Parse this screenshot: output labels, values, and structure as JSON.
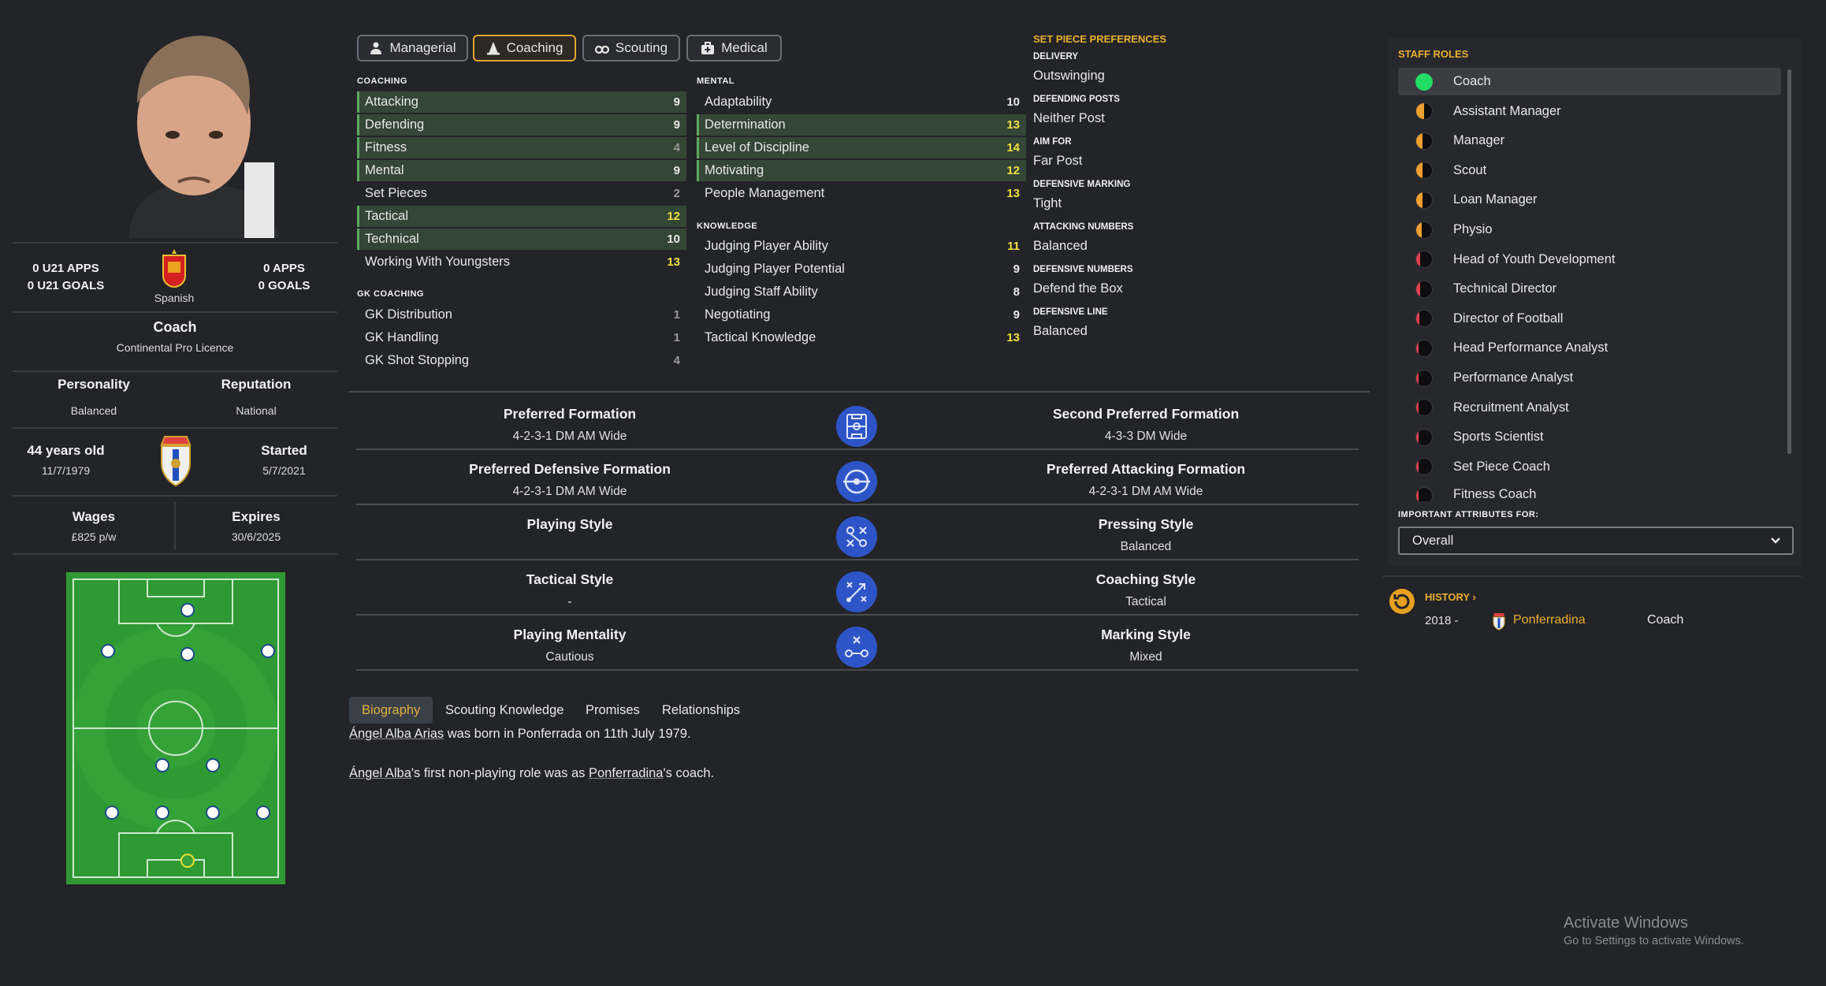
{
  "profile": {
    "u21_apps": "0 U21 APPS",
    "u21_goals": "0 U21 GOALS",
    "apps": "0 APPS",
    "goals": "0 GOALS",
    "nationality": "Spanish",
    "role": "Coach",
    "licence": "Continental Pro Licence",
    "personality_label": "Personality",
    "personality": "Balanced",
    "reputation_label": "Reputation",
    "reputation": "National",
    "age": "44 years old",
    "dob": "11/7/1979",
    "started_label": "Started",
    "started": "5/7/2021",
    "wages_label": "Wages",
    "wages": "£825 p/w",
    "expires_label": "Expires",
    "expires": "30/6/2025"
  },
  "tabs": [
    {
      "label": "Managerial",
      "icon": "manager-icon"
    },
    {
      "label": "Coaching",
      "icon": "cone-icon"
    },
    {
      "label": "Scouting",
      "icon": "binoculars-icon"
    },
    {
      "label": "Medical",
      "icon": "medkit-icon"
    }
  ],
  "coaching": {
    "title": "COACHING",
    "items": [
      {
        "name": "Attacking",
        "value": "9",
        "hl": true
      },
      {
        "name": "Defending",
        "value": "9",
        "hl": true
      },
      {
        "name": "Fitness",
        "value": "4",
        "hl": true
      },
      {
        "name": "Mental",
        "value": "9",
        "hl": true
      },
      {
        "name": "Set Pieces",
        "value": "2",
        "hl": false
      },
      {
        "name": "Tactical",
        "value": "12",
        "hl": true
      },
      {
        "name": "Technical",
        "value": "10",
        "hl": true
      },
      {
        "name": "Working With Youngsters",
        "value": "13",
        "hl": false
      }
    ]
  },
  "gk_coaching": {
    "title": "GK COACHING",
    "items": [
      {
        "name": "GK Distribution",
        "value": "1"
      },
      {
        "name": "GK Handling",
        "value": "1"
      },
      {
        "name": "GK Shot Stopping",
        "value": "4"
      }
    ]
  },
  "mental": {
    "title": "MENTAL",
    "items": [
      {
        "name": "Adaptability",
        "value": "10",
        "hl": false
      },
      {
        "name": "Determination",
        "value": "13",
        "hl": true
      },
      {
        "name": "Level of Discipline",
        "value": "14",
        "hl": true
      },
      {
        "name": "Motivating",
        "value": "12",
        "hl": true
      },
      {
        "name": "People Management",
        "value": "13",
        "hl": false
      }
    ]
  },
  "knowledge": {
    "title": "KNOWLEDGE",
    "items": [
      {
        "name": "Judging Player Ability",
        "value": "11"
      },
      {
        "name": "Judging Player Potential",
        "value": "9"
      },
      {
        "name": "Judging Staff Ability",
        "value": "8"
      },
      {
        "name": "Negotiating",
        "value": "9"
      },
      {
        "name": "Tactical Knowledge",
        "value": "13"
      }
    ]
  },
  "set_piece": {
    "title": "SET PIECE PREFERENCES",
    "items": [
      {
        "label": "DELIVERY",
        "value": "Outswinging"
      },
      {
        "label": "DEFENDING POSTS",
        "value": "Neither Post"
      },
      {
        "label": "AIM FOR",
        "value": "Far Post"
      },
      {
        "label": "DEFENSIVE MARKING",
        "value": "Tight"
      },
      {
        "label": "ATTACKING NUMBERS",
        "value": "Balanced"
      },
      {
        "label": "DEFENSIVE NUMBERS",
        "value": "Defend the Box"
      },
      {
        "label": "DEFENSIVE LINE",
        "value": "Balanced"
      }
    ]
  },
  "tactics": [
    {
      "left_label": "Preferred Formation",
      "left_value": "4-2-3-1 DM AM Wide",
      "right_label": "Second Preferred Formation",
      "right_value": "4-3-3 DM Wide",
      "icon": "pitch-icon"
    },
    {
      "left_label": "Preferred Defensive Formation",
      "left_value": "4-2-3-1 DM AM Wide",
      "right_label": "Preferred Attacking Formation",
      "right_value": "4-2-3-1 DM AM Wide",
      "icon": "target-icon"
    },
    {
      "left_label": "Playing Style",
      "left_value": "",
      "right_label": "Pressing Style",
      "right_value": "Balanced",
      "icon": "playing-style-icon"
    },
    {
      "left_label": "Tactical Style",
      "left_value": "-",
      "right_label": "Coaching Style",
      "right_value": "Tactical",
      "icon": "tactics-board-icon"
    },
    {
      "left_label": "Playing Mentality",
      "left_value": "Cautious",
      "right_label": "Marking Style",
      "right_value": "Mixed",
      "icon": "marking-icon"
    }
  ],
  "bottom_tabs": [
    "Biography",
    "Scouting Knowledge",
    "Promises",
    "Relationships"
  ],
  "biography": {
    "p1_name": "Ángel Alba Arias",
    "p1_rest": " was born in Ponferrada on 11th July 1979.",
    "p2_name": "Ángel Alba",
    "p2_mid": "'s first non-playing role was as ",
    "p2_club": "Ponferradina",
    "p2_end": "'s coach."
  },
  "staff_roles": {
    "title": "STAFF ROLES",
    "items": [
      {
        "name": "Coach",
        "fill": 1.0
      },
      {
        "name": "Assistant Manager",
        "fill": 0.5
      },
      {
        "name": "Manager",
        "fill": 0.4
      },
      {
        "name": "Scout",
        "fill": 0.4
      },
      {
        "name": "Loan Manager",
        "fill": 0.4
      },
      {
        "name": "Physio",
        "fill": 0.35
      },
      {
        "name": "Head of Youth Development",
        "fill": 0.25
      },
      {
        "name": "Technical Director",
        "fill": 0.25
      },
      {
        "name": "Director of Football",
        "fill": 0.2
      },
      {
        "name": "Head Performance Analyst",
        "fill": 0.15
      },
      {
        "name": "Performance Analyst",
        "fill": 0.15
      },
      {
        "name": "Recruitment Analyst",
        "fill": 0.15
      },
      {
        "name": "Sports Scientist",
        "fill": 0.15
      },
      {
        "name": "Set Piece Coach",
        "fill": 0.15
      },
      {
        "name": "Fitness Coach",
        "fill": 0.15
      }
    ],
    "important_label": "IMPORTANT ATTRIBUTES FOR:",
    "dropdown_value": "Overall"
  },
  "history": {
    "title": "HISTORY",
    "year": "2018 -",
    "club": "Ponferradina",
    "role": "Coach"
  },
  "windows": {
    "line1": "Activate Windows",
    "line2": "Go to Settings to activate Windows."
  },
  "colors": {
    "accent": "#e8b030",
    "highlight_row": "#344636",
    "icon_blue": "#2e55c7",
    "role_green": "#22dd66",
    "role_orange": "#f0a030",
    "role_red": "#e04050"
  }
}
